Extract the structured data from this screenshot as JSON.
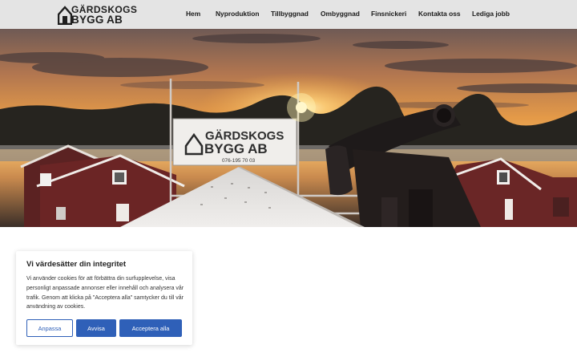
{
  "brand": {
    "logo_line1": "GÄRDSKOGS",
    "logo_line2": "BYGG AB",
    "logo_icon": "house-icon"
  },
  "nav": {
    "items": [
      {
        "label": "Hem"
      },
      {
        "label": "Nyproduktion"
      },
      {
        "label": "Tillbyggnad"
      },
      {
        "label": "Ombyggnad"
      },
      {
        "label": "Finsnickeri"
      },
      {
        "label": "Kontakta oss"
      },
      {
        "label": "Lediga jobb"
      }
    ]
  },
  "hero": {
    "sign_line1": "GÄRDSKOGS",
    "sign_line2": "BYGG AB",
    "sign_phone": "076-195 70 03"
  },
  "cookie": {
    "title": "Vi värdesätter din integritet",
    "body": "Vi använder cookies för att förbättra din surfupplevelse, visa personligt anpassade annonser eller innehåll och analysera vår trafik. Genom att klicka på \"Acceptera alla\" samtycker du till vår användning av cookies.",
    "customize_label": "Anpassa",
    "reject_label": "Avvisa",
    "accept_label": "Acceptera alla"
  },
  "colors": {
    "header_bg": "#e4e4e4",
    "button_primary": "#2f60b8",
    "sky_sunset": "#f4a23a"
  }
}
